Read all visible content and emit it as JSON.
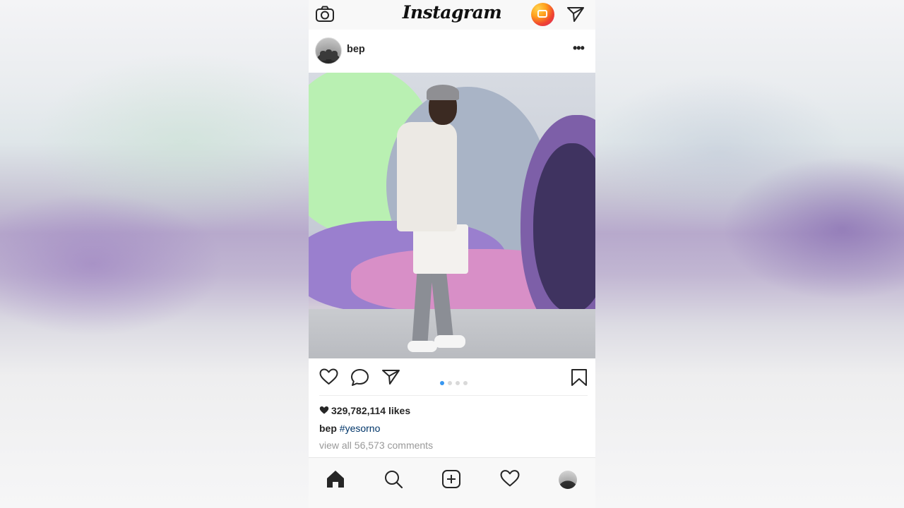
{
  "app": {
    "title": "Instagram"
  },
  "topbar": {
    "camera_icon": "camera-icon",
    "igtv_icon": "igtv-icon",
    "direct_icon": "paper-plane-icon"
  },
  "post": {
    "username": "bep",
    "more_label": "•••",
    "carousel": {
      "count": 4,
      "active_index": 0
    },
    "likes_text": "329,782,114 likes",
    "caption": {
      "author": "bep",
      "text": "#yesorno"
    },
    "comments_link": "view all 56,573 comments"
  },
  "tabbar": {
    "items": [
      "home-icon",
      "search-icon",
      "add-post-icon",
      "activity-heart-icon",
      "profile-avatar"
    ]
  },
  "colors": {
    "link_blue": "#003569",
    "dot_active": "#3897f0",
    "muted_text": "#999999",
    "text": "#262626"
  }
}
